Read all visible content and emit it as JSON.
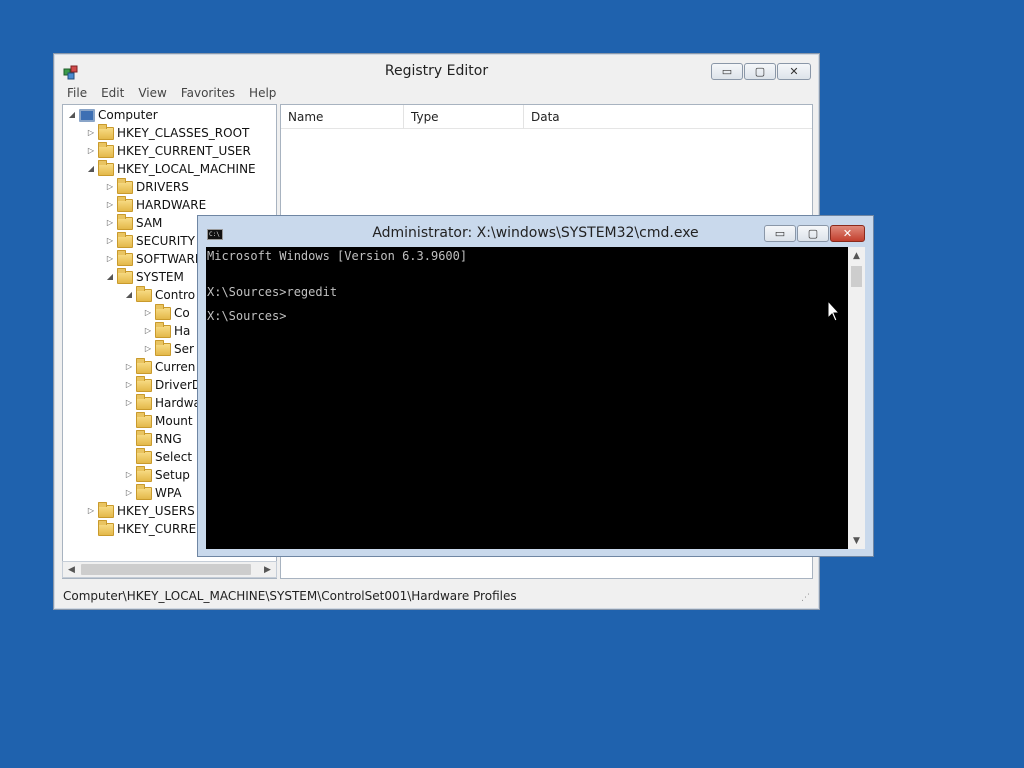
{
  "registry_editor": {
    "title": "Registry Editor",
    "icon": "registry-editor-icon",
    "caption_buttons": {
      "minimize": "▭",
      "maximize": "▢",
      "close": "✕"
    },
    "menu": [
      "File",
      "Edit",
      "View",
      "Favorites",
      "Help"
    ],
    "tree": [
      {
        "label": "Computer",
        "level": 0,
        "state": "expanded",
        "icon": "computer-icon"
      },
      {
        "label": "HKEY_CLASSES_ROOT",
        "level": 1,
        "state": "collapsed",
        "icon": "folder-icon"
      },
      {
        "label": "HKEY_CURRENT_USER",
        "level": 1,
        "state": "collapsed",
        "icon": "folder-icon"
      },
      {
        "label": "HKEY_LOCAL_MACHINE",
        "level": 1,
        "state": "expanded",
        "icon": "folder-icon"
      },
      {
        "label": "DRIVERS",
        "level": 2,
        "state": "collapsed",
        "icon": "folder-icon"
      },
      {
        "label": "HARDWARE",
        "level": 2,
        "state": "collapsed",
        "icon": "folder-icon"
      },
      {
        "label": "SAM",
        "level": 2,
        "state": "collapsed",
        "icon": "folder-icon"
      },
      {
        "label": "SECURITY",
        "level": 2,
        "state": "collapsed",
        "icon": "folder-icon"
      },
      {
        "label": "SOFTWARE",
        "level": 2,
        "state": "collapsed",
        "icon": "folder-icon"
      },
      {
        "label": "SYSTEM",
        "level": 2,
        "state": "expanded",
        "icon": "folder-icon"
      },
      {
        "label": "Contro",
        "level": 3,
        "state": "expanded",
        "icon": "folder-icon"
      },
      {
        "label": "Co",
        "level": 4,
        "state": "collapsed",
        "icon": "folder-icon"
      },
      {
        "label": "Ha",
        "level": 4,
        "state": "collapsed",
        "icon": "folder-icon"
      },
      {
        "label": "Ser",
        "level": 4,
        "state": "collapsed",
        "icon": "folder-icon"
      },
      {
        "label": "Curren",
        "level": 3,
        "state": "collapsed",
        "icon": "folder-icon"
      },
      {
        "label": "DriverD",
        "level": 3,
        "state": "collapsed",
        "icon": "folder-icon"
      },
      {
        "label": "Hardwa",
        "level": 3,
        "state": "collapsed",
        "icon": "folder-icon"
      },
      {
        "label": "Mount",
        "level": 3,
        "state": "none",
        "icon": "folder-icon"
      },
      {
        "label": "RNG",
        "level": 3,
        "state": "none",
        "icon": "folder-icon"
      },
      {
        "label": "Select",
        "level": 3,
        "state": "none",
        "icon": "folder-icon"
      },
      {
        "label": "Setup",
        "level": 3,
        "state": "collapsed",
        "icon": "folder-icon"
      },
      {
        "label": "WPA",
        "level": 3,
        "state": "collapsed",
        "icon": "folder-icon"
      },
      {
        "label": "HKEY_USERS",
        "level": 1,
        "state": "collapsed",
        "icon": "folder-icon"
      },
      {
        "label": "HKEY_CURREN",
        "level": 1,
        "state": "none",
        "icon": "folder-icon"
      }
    ],
    "columns": {
      "name": "Name",
      "type": "Type",
      "data": "Data"
    },
    "status_path": "Computer\\HKEY_LOCAL_MACHINE\\SYSTEM\\ControlSet001\\Hardware Profiles"
  },
  "cmd": {
    "title": "Administrator: X:\\windows\\SYSTEM32\\cmd.exe",
    "icon_text": "C:\\",
    "caption_buttons": {
      "minimize": "▭",
      "maximize": "▢",
      "close": "✕"
    },
    "lines": [
      "Microsoft Windows [Version 6.3.9600]",
      "",
      "X:\\Sources>regedit",
      "",
      "X:\\Sources>"
    ]
  }
}
